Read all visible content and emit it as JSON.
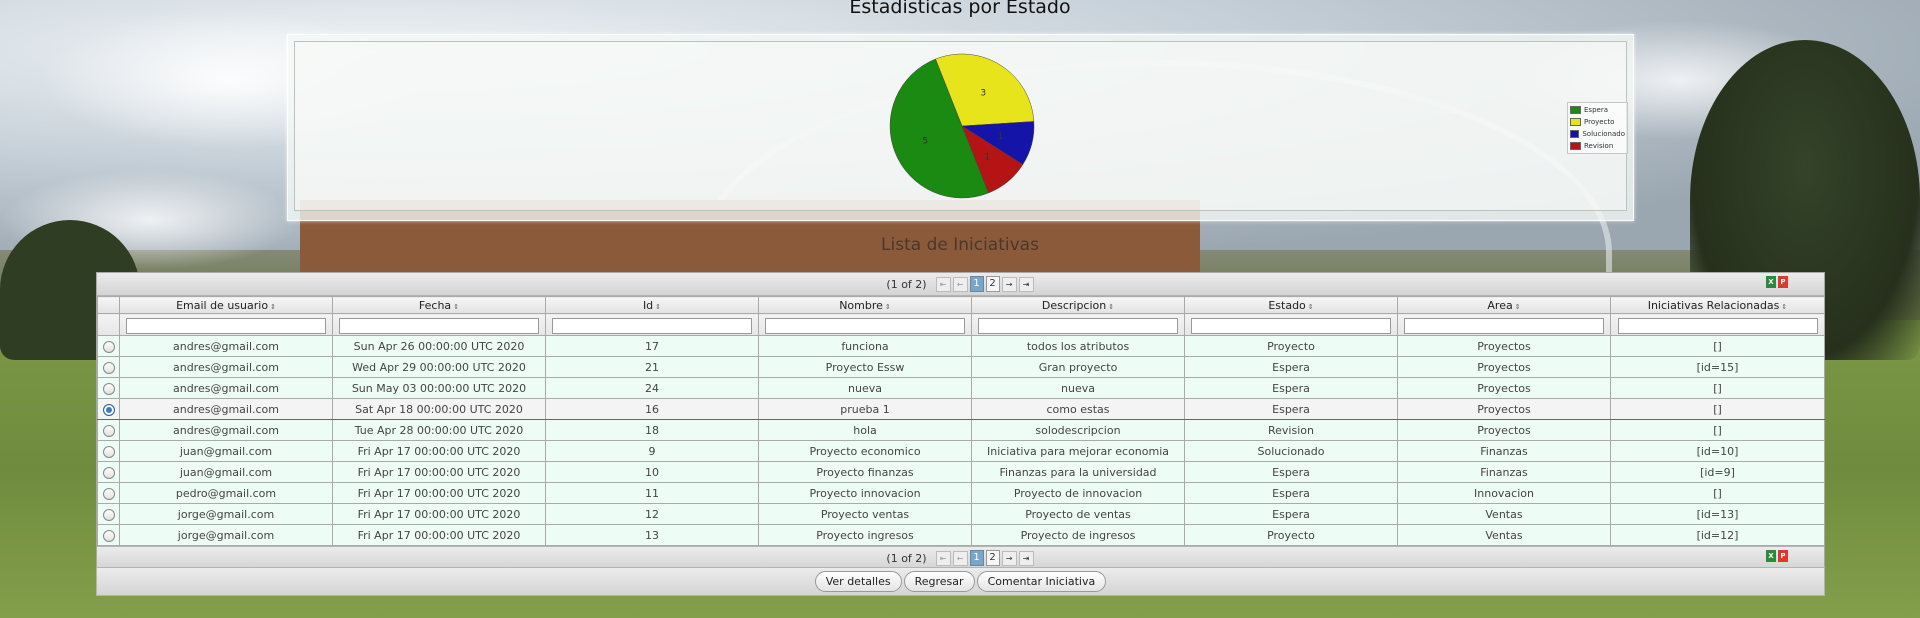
{
  "page": {
    "title": "Estadisticas por Estado",
    "table_title": "Lista de Iniciativas"
  },
  "chart_data": {
    "type": "pie",
    "title": "",
    "slices": [
      {
        "label": "Espera",
        "value": 5,
        "color": "#1a8a12"
      },
      {
        "label": "Proyecto",
        "value": 3,
        "color": "#e8e41c"
      },
      {
        "label": "Solucionado",
        "value": 1,
        "color": "#1414a8"
      },
      {
        "label": "Revision",
        "value": 1,
        "color": "#b41414"
      }
    ],
    "slice_labels": [
      "3",
      "1",
      "1",
      "5"
    ],
    "legend_position": "right"
  },
  "paginator": {
    "current": "(1 of 2)",
    "pages": [
      "1",
      "2"
    ],
    "first": "⇤",
    "prev": "←",
    "next": "→",
    "last": "⇥"
  },
  "columns": [
    "Email de usuario",
    "Fecha",
    "Id",
    "Nombre",
    "Descripcion",
    "Estado",
    "Area",
    "Iniciativas Relacionadas"
  ],
  "rows": [
    [
      "andres@gmail.com",
      "Sun Apr 26 00:00:00 UTC 2020",
      "17",
      "funciona",
      "todos los atributos",
      "Proyecto",
      "Proyectos",
      "[]"
    ],
    [
      "andres@gmail.com",
      "Wed Apr 29 00:00:00 UTC 2020",
      "21",
      "Proyecto Essw",
      "Gran proyecto",
      "Espera",
      "Proyectos",
      "[id=15]"
    ],
    [
      "andres@gmail.com",
      "Sun May 03 00:00:00 UTC 2020",
      "24",
      "nueva",
      "nueva",
      "Espera",
      "Proyectos",
      "[]"
    ],
    [
      "andres@gmail.com",
      "Sat Apr 18 00:00:00 UTC 2020",
      "16",
      "prueba 1",
      "como estas",
      "Espera",
      "Proyectos",
      "[]"
    ],
    [
      "andres@gmail.com",
      "Tue Apr 28 00:00:00 UTC 2020",
      "18",
      "hola",
      "solodescripcion",
      "Revision",
      "Proyectos",
      "[]"
    ],
    [
      "juan@gmail.com",
      "Fri Apr 17 00:00:00 UTC 2020",
      "9",
      "Proyecto economico",
      "Iniciativa para mejorar economia",
      "Solucionado",
      "Finanzas",
      "[id=10]"
    ],
    [
      "juan@gmail.com",
      "Fri Apr 17 00:00:00 UTC 2020",
      "10",
      "Proyecto finanzas",
      "Finanzas para la universidad",
      "Espera",
      "Finanzas",
      "[id=9]"
    ],
    [
      "pedro@gmail.com",
      "Fri Apr 17 00:00:00 UTC 2020",
      "11",
      "Proyecto innovacion",
      "Proyecto de innovacion",
      "Espera",
      "Innovacion",
      "[]"
    ],
    [
      "jorge@gmail.com",
      "Fri Apr 17 00:00:00 UTC 2020",
      "12",
      "Proyecto ventas",
      "Proyecto de ventas",
      "Espera",
      "Ventas",
      "[id=13]"
    ],
    [
      "jorge@gmail.com",
      "Fri Apr 17 00:00:00 UTC 2020",
      "13",
      "Proyecto ingresos",
      "Proyecto de ingresos",
      "Proyecto",
      "Ventas",
      "[id=12]"
    ]
  ],
  "selected_row": 3,
  "actions": {
    "details": "Ver detalles",
    "back": "Regresar",
    "comment": "Comentar Iniciativa"
  },
  "export": {
    "xls": "X",
    "pdf": "P"
  }
}
